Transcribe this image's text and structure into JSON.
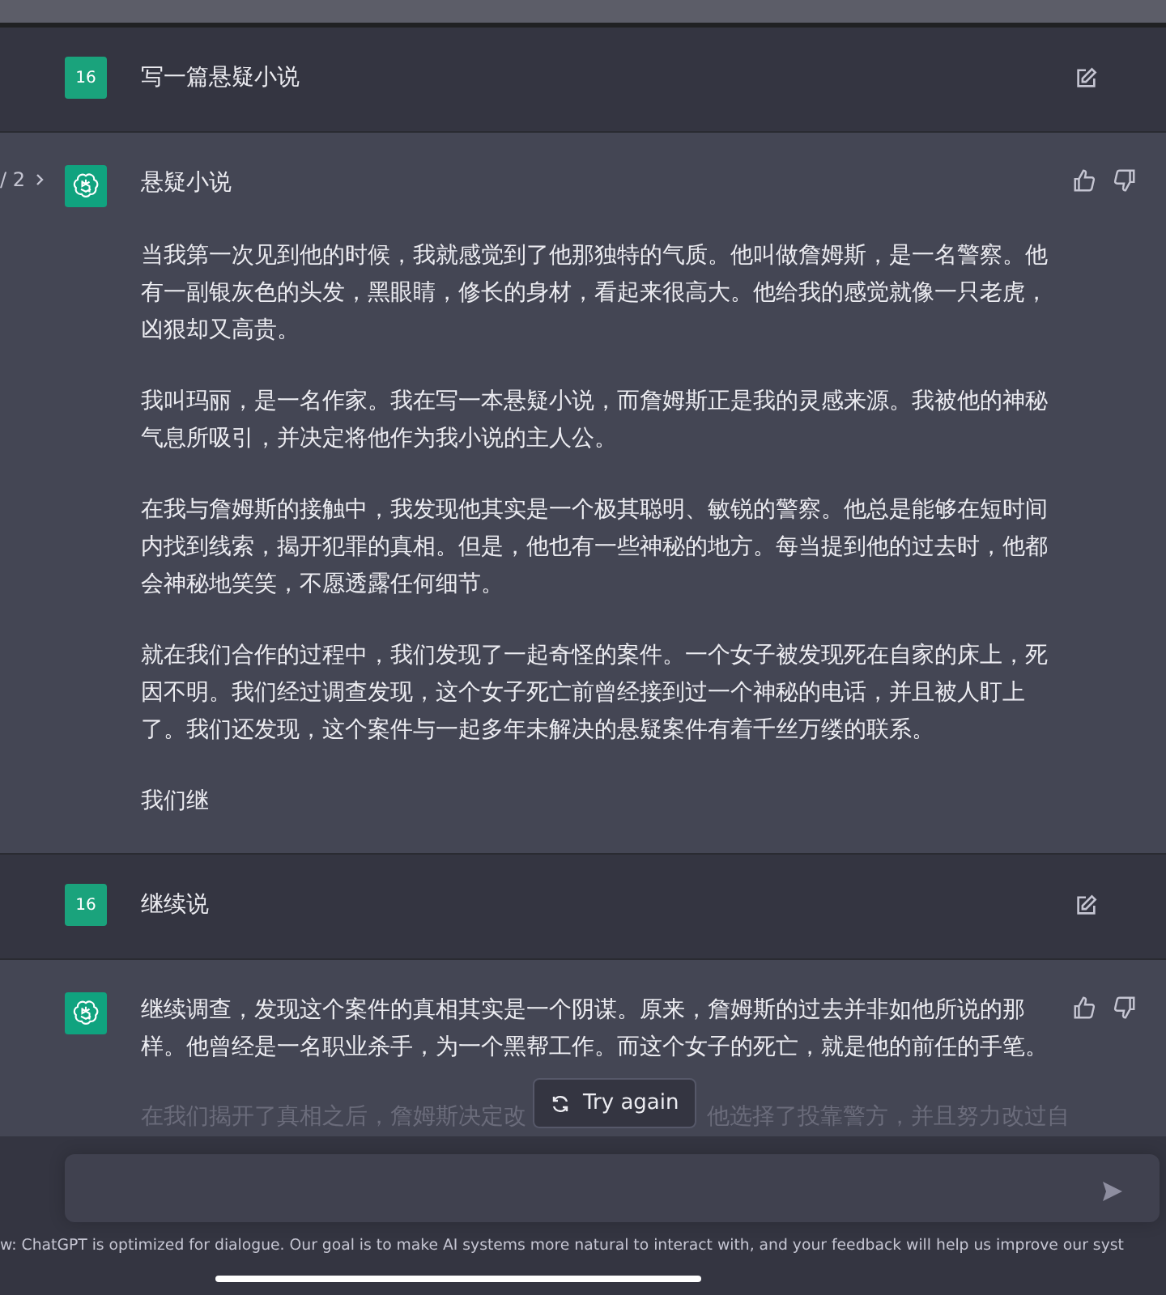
{
  "messages": [
    {
      "kind": "user",
      "avatar": "16",
      "text": "写一篇悬疑小说"
    },
    {
      "kind": "assistant",
      "pager": "/ 2",
      "title": "悬疑小说",
      "paragraphs": [
        "当我第一次见到他的时候，我就感觉到了他那独特的气质。他叫做詹姆斯，是一名警察。他有一副银灰色的头发，黑眼睛，修长的身材，看起来很高大。他给我的感觉就像一只老虎，凶狠却又高贵。",
        "我叫玛丽，是一名作家。我在写一本悬疑小说，而詹姆斯正是我的灵感来源。我被他的神秘气息所吸引，并决定将他作为我小说的主人公。",
        "在我与詹姆斯的接触中，我发现他其实是一个极其聪明、敏锐的警察。他总是能够在短时间内找到线索，揭开犯罪的真相。但是，他也有一些神秘的地方。每当提到他的过去时，他都会神秘地笑笑，不愿透露任何细节。",
        "就在我们合作的过程中，我们发现了一起奇怪的案件。一个女子被发现死在自家的床上，死因不明。我们经过调查发现，这个女子死亡前曾经接到过一个神秘的电话，并且被人盯上了。我们还发现，这个案件与一起多年未解决的悬疑案件有着千丝万缕的联系。",
        "我们继"
      ]
    },
    {
      "kind": "user",
      "avatar": "16",
      "text": "继续说"
    },
    {
      "kind": "assistant",
      "paragraphs": [
        "继续调查，发现这个案件的真相其实是一个阴谋。原来，詹姆斯的过去并非如他所说的那样。他曾经是一名职业杀手，为一个黑帮工作。而这个女子的死亡，就是他的前任的手笔。"
      ],
      "faded": [
        "在我们揭开了真相之后，詹姆斯决定改",
        "他选择了投靠警方，并且努力改过自"
      ]
    }
  ],
  "try_again": "Try again",
  "footer": "w: ChatGPT is optimized for dialogue. Our goal is to make AI systems more natural to interact with, and your feedback will help us improve our syst"
}
